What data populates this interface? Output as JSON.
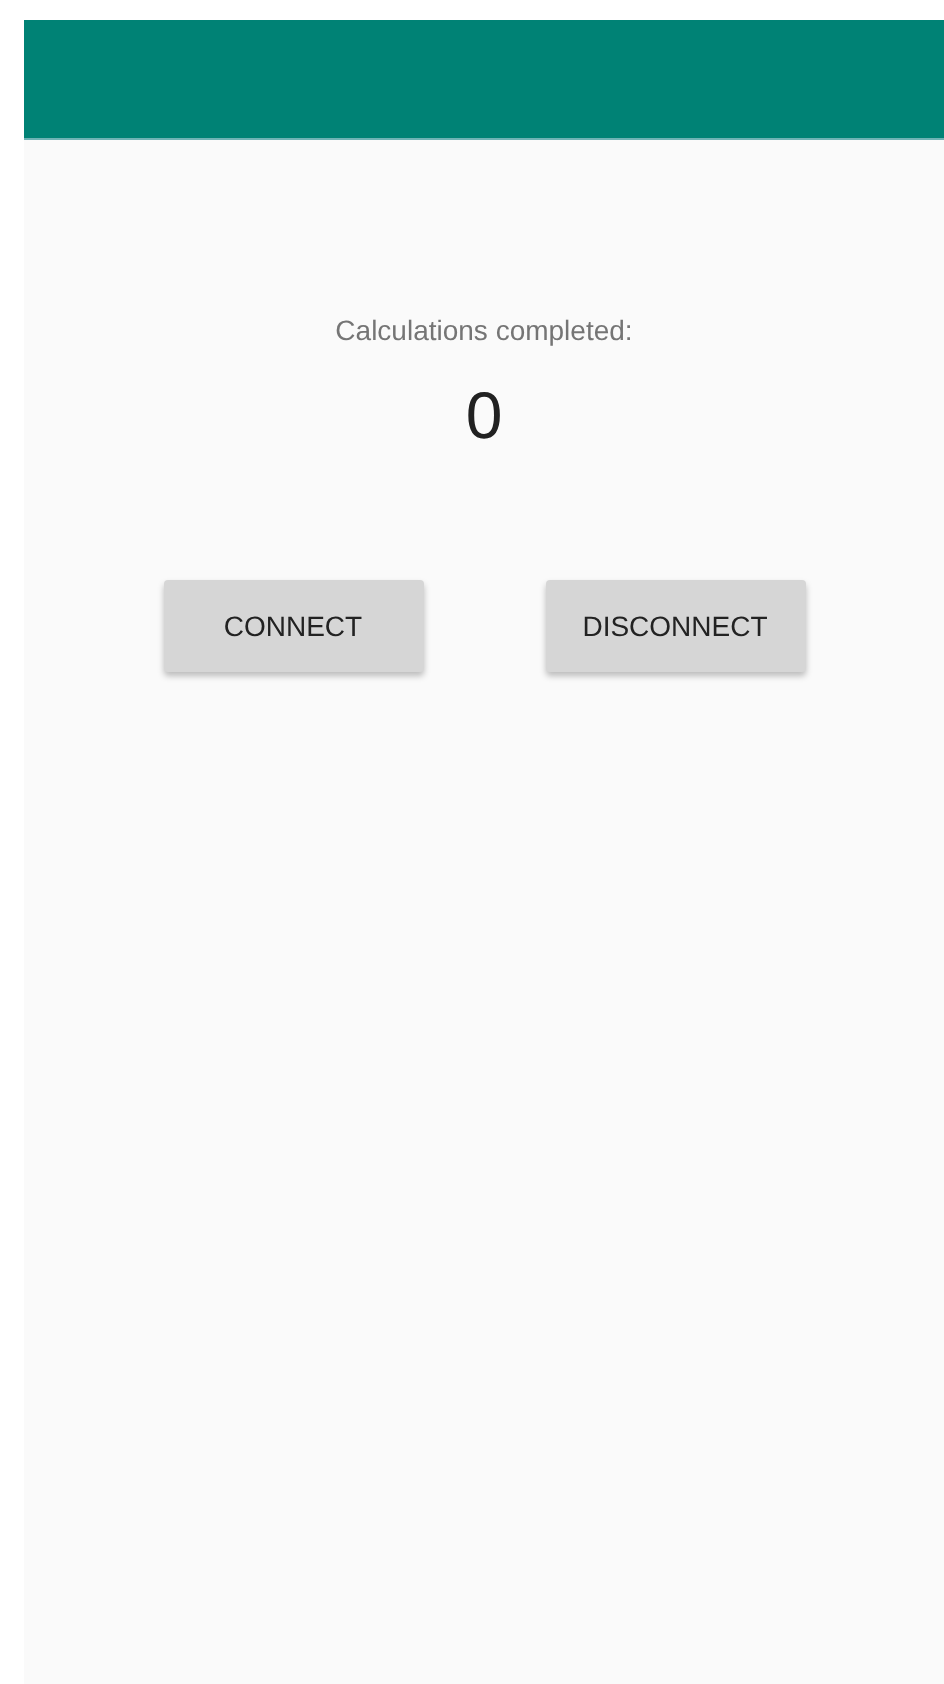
{
  "counter": {
    "label": "Calculations completed:",
    "value": "0"
  },
  "buttons": [
    {
      "label": "CONNECT"
    },
    {
      "label": "DISCONNECT"
    }
  ]
}
